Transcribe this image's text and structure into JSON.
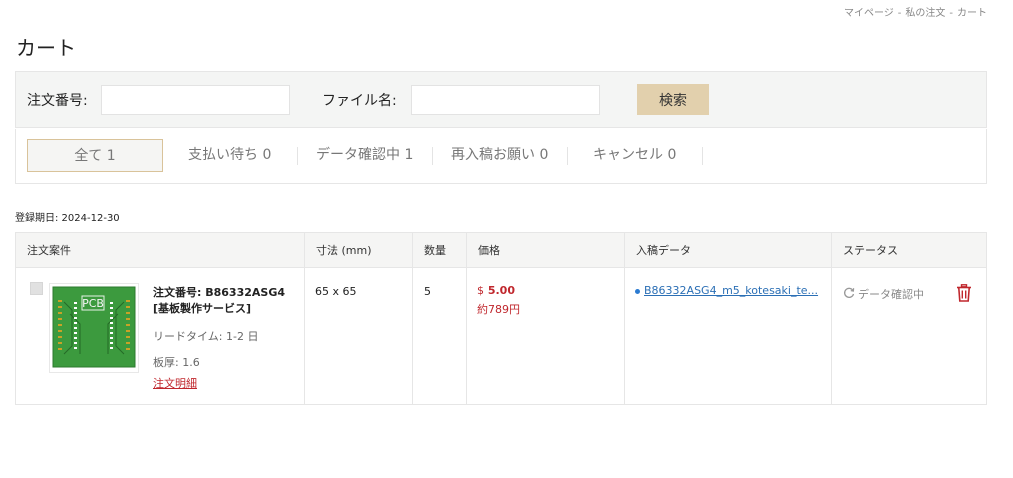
{
  "breadcrumb": [
    "マイページ",
    "私の注文",
    "カート"
  ],
  "breadcrumb_sep": "-",
  "page_title": "カート",
  "search": {
    "order_no_label": "注文番号:",
    "order_no_value": "",
    "file_name_label": "ファイル名:",
    "file_name_value": "",
    "button_label": "検索"
  },
  "tabs": [
    {
      "label": "全て 1",
      "active": true
    },
    {
      "label": "支払い待ち 0",
      "active": false
    },
    {
      "label": "データ確認中 1",
      "active": false
    },
    {
      "label": "再入稿お願い 0",
      "active": false
    },
    {
      "label": "キャンセル 0",
      "active": false
    }
  ],
  "registration_date": "登録期日: 2024-12-30",
  "table": {
    "headers": [
      "注文案件",
      "寸法 (mm)",
      "数量",
      "価格",
      "入稿データ",
      "ステータス"
    ],
    "row": {
      "thumb_label": "PCB",
      "order_no": "注文番号: B86332ASG4",
      "service": "[基板製作サービス]",
      "lead_time": "リードタイム: 1-2 日",
      "thickness": "板厚: 1.6",
      "detail_link": "注文明細",
      "size": "65 x 65",
      "qty": "5",
      "price_symbol": "$",
      "price": "5.00",
      "price_jpy": "約789円",
      "file": "B86332ASG4_m5_kotesaki_te...",
      "status": "データ確認中"
    }
  },
  "colors": {
    "accent_border": "#d9c39a",
    "search_button": "#e2d0ad",
    "price_red": "#c0272d",
    "link_blue": "#2b6fb5",
    "pcb_green": "#3c9a3e"
  }
}
